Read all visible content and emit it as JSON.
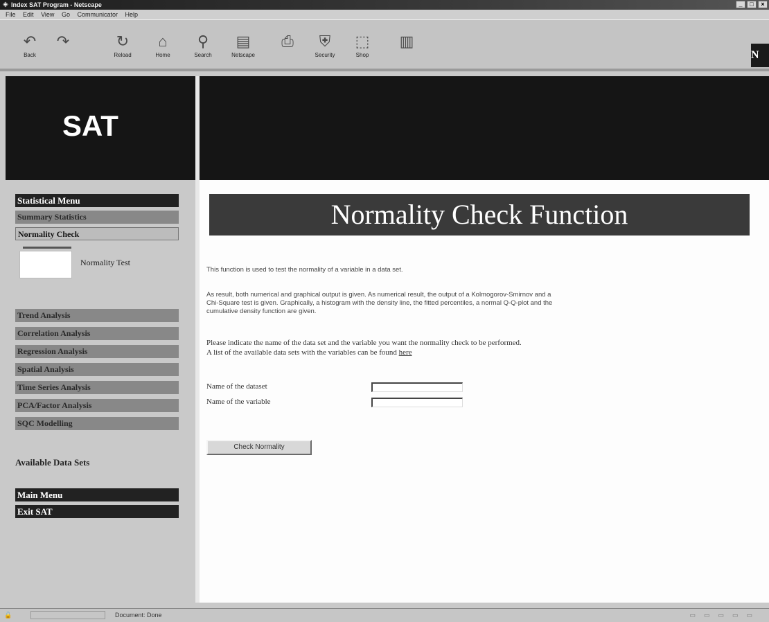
{
  "window": {
    "title": "Index SAT Program - Netscape",
    "menu": [
      "File",
      "Edit",
      "View",
      "Go",
      "Communicator",
      "Help"
    ]
  },
  "toolbar": {
    "buttons": [
      {
        "label": "Back",
        "icon": "back-arrow-icon"
      },
      {
        "label": "",
        "icon": "forward-arrow-icon"
      },
      {
        "label": "Reload",
        "icon": "reload-icon"
      },
      {
        "label": "Home",
        "icon": "home-icon"
      },
      {
        "label": "Search",
        "icon": "search-icon"
      },
      {
        "label": "Netscape",
        "icon": "netscape-icon"
      },
      {
        "label": "",
        "icon": "print-icon"
      },
      {
        "label": "Security",
        "icon": "lock-icon"
      },
      {
        "label": "Shop",
        "icon": "shop-icon"
      },
      {
        "label": "",
        "icon": "stop-icon"
      }
    ],
    "logo": "N"
  },
  "header": {
    "left_title": "SAT"
  },
  "sidebar": {
    "top_items": [
      {
        "label": "Statistical Menu",
        "style": "dark"
      },
      {
        "label": "Summary Statistics",
        "style": "mid"
      },
      {
        "label": "Normality Check",
        "style": "active"
      }
    ],
    "sub_item": "Normality Test",
    "mid_items": [
      "Trend Analysis",
      "Correlation Analysis",
      "Regression Analysis",
      "Spatial Analysis",
      "Time Series Analysis",
      "PCA/Factor Analysis",
      "SQC Modelling"
    ],
    "data_sets_label": "Available Data Sets",
    "bottom_items": [
      "Main Menu",
      "Exit SAT"
    ]
  },
  "main": {
    "banner_title": "Normality Check Function",
    "para1": "This function is used to test the normality of a variable in a data set.",
    "para2_line1": "As result, both numerical and graphical output is given. As numerical result, the output of a Kolmogorov-Smirnov and a",
    "para2_line2": "Chi-Square test is given. Graphically, a histogram with the density line, the fitted percentiles, a normal Q-Q-plot and the",
    "para2_line3": "cumulative density function are given.",
    "para3_line1": "Please indicate the name of the data set and the variable you want the normality check to be performed.",
    "para3_line2_prefix": "A list of the available data sets with the variables can be found ",
    "para3_link": "here",
    "form": {
      "dataset_label": "Name of the dataset",
      "variable_label": "Name of the variable",
      "dataset_value": "",
      "variable_value": ""
    },
    "submit_label": "Check Normality"
  },
  "statusbar": {
    "text": "Document: Done"
  }
}
